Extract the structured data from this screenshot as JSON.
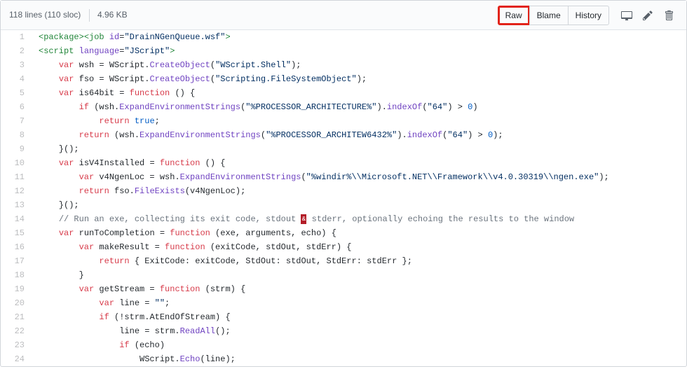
{
  "header": {
    "lines": "118 lines (110 sloc)",
    "size": "4.96 KB",
    "raw": "Raw",
    "blame": "Blame",
    "history": "History"
  },
  "code": [
    {
      "n": 1,
      "html": "<span class='pl-ent'>&lt;package&gt;</span><span class='pl-ent'>&lt;job</span> <span class='pl-e'>id</span>=<span class='pl-s'>\"DrainNGenQueue.wsf\"</span><span class='pl-ent'>&gt;</span>"
    },
    {
      "n": 2,
      "html": "<span class='pl-ent'>&lt;script</span> <span class='pl-e'>language</span>=<span class='pl-s'>\"JScript\"</span><span class='pl-ent'>&gt;</span>"
    },
    {
      "n": 3,
      "html": "    <span class='pl-k'>var</span> wsh = WScript.<span class='pl-en'>CreateObject</span>(<span class='pl-s'>\"WScript.Shell\"</span>);"
    },
    {
      "n": 4,
      "html": "    <span class='pl-k'>var</span> fso = WScript.<span class='pl-en'>CreateObject</span>(<span class='pl-s'>\"Scripting.FileSystemObject\"</span>);"
    },
    {
      "n": 5,
      "html": "    <span class='pl-k'>var</span> is64bit = <span class='pl-k'>function</span> () {"
    },
    {
      "n": 6,
      "html": "        <span class='pl-k'>if</span> (wsh.<span class='pl-en'>ExpandEnvironmentStrings</span>(<span class='pl-s'>\"%PROCESSOR_ARCHITECTURE%\"</span>).<span class='pl-en'>indexOf</span>(<span class='pl-s'>\"64\"</span>) &gt; <span class='pl-c1'>0</span>)"
    },
    {
      "n": 7,
      "html": "            <span class='pl-k'>return</span> <span class='pl-c1'>true</span>;"
    },
    {
      "n": 8,
      "html": "        <span class='pl-k'>return</span> (wsh.<span class='pl-en'>ExpandEnvironmentStrings</span>(<span class='pl-s'>\"%PROCESSOR_ARCHITEW6432%\"</span>).<span class='pl-en'>indexOf</span>(<span class='pl-s'>\"64\"</span>) &gt; <span class='pl-c1'>0</span>);"
    },
    {
      "n": 9,
      "html": "    }();"
    },
    {
      "n": 10,
      "html": "    <span class='pl-k'>var</span> isV4Installed = <span class='pl-k'>function</span> () {"
    },
    {
      "n": 11,
      "html": "        <span class='pl-k'>var</span> v4NgenLoc = wsh.<span class='pl-en'>ExpandEnvironmentStrings</span>(<span class='pl-s'>\"%windir%\\\\Microsoft.NET\\\\Framework\\\\v4.0.30319\\\\ngen.exe\"</span>);"
    },
    {
      "n": 12,
      "html": "        <span class='pl-k'>return</span> fso.<span class='pl-en'>FileExists</span>(v4NgenLoc);"
    },
    {
      "n": 13,
      "html": "    }();"
    },
    {
      "n": 14,
      "html": "    <span class='pl-c'>// Run an exe, collecting its exit code, stdout <span class='hlchar'>&amp;</span> stderr, optionally echoing the results to the window</span>"
    },
    {
      "n": 15,
      "html": "    <span class='pl-k'>var</span> runToCompletion = <span class='pl-k'>function</span> (exe, arguments, echo) {"
    },
    {
      "n": 16,
      "html": "        <span class='pl-k'>var</span> makeResult = <span class='pl-k'>function</span> (exitCode, stdOut, stdErr) {"
    },
    {
      "n": 17,
      "html": "            <span class='pl-k'>return</span> { ExitCode: exitCode, StdOut: stdOut, StdErr: stdErr };"
    },
    {
      "n": 18,
      "html": "        }"
    },
    {
      "n": 19,
      "html": "        <span class='pl-k'>var</span> getStream = <span class='pl-k'>function</span> (strm) {"
    },
    {
      "n": 20,
      "html": "            <span class='pl-k'>var</span> line = <span class='pl-s'>\"\"</span>;"
    },
    {
      "n": 21,
      "html": "            <span class='pl-k'>if</span> (!strm.AtEndOfStream) {"
    },
    {
      "n": 22,
      "html": "                line = strm.<span class='pl-en'>ReadAll</span>();"
    },
    {
      "n": 23,
      "html": "                <span class='pl-k'>if</span> (echo)"
    },
    {
      "n": 24,
      "html": "                    WScript.<span class='pl-en'>Echo</span>(line);"
    }
  ]
}
